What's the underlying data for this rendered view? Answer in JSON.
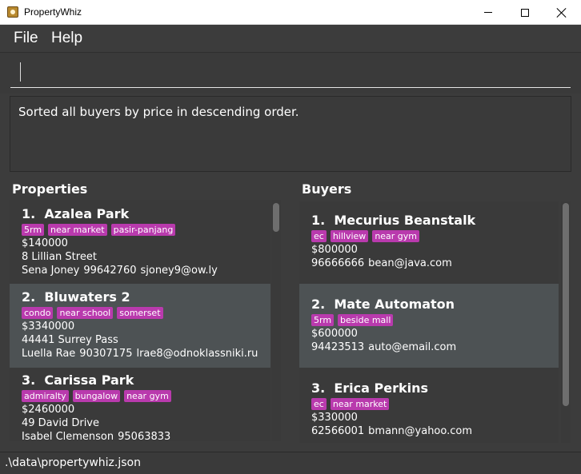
{
  "window": {
    "title": "PropertyWhiz"
  },
  "menu": {
    "file": "File",
    "help": "Help"
  },
  "command": {
    "value": "",
    "placeholder": ""
  },
  "result": {
    "text": "Sorted all buyers by price in descending order."
  },
  "properties": {
    "title": "Properties",
    "items": [
      {
        "index": "1.",
        "name": "Azalea Park",
        "tags": [
          "5rm",
          "near market",
          "pasir-panjang"
        ],
        "price": "$140000",
        "address": "8 Lillian Street",
        "seller": "Sena Joney",
        "phone": "99642760",
        "email": "sjoney9@ow.ly"
      },
      {
        "index": "2.",
        "name": "Bluwaters 2",
        "tags": [
          "condo",
          "near school",
          "somerset"
        ],
        "price": "$3340000",
        "address": "44441 Surrey Pass",
        "seller": "Luella Rae",
        "phone": "90307175",
        "email": "lrae8@odnoklassniki.ru"
      },
      {
        "index": "3.",
        "name": "Carissa Park",
        "tags": [
          "admiralty",
          "bungalow",
          "near gym"
        ],
        "price": "$2460000",
        "address": "49 David Drive",
        "seller": "Isabel Clemenson",
        "phone": "95063833",
        "email": ""
      }
    ]
  },
  "buyers": {
    "title": "Buyers",
    "items": [
      {
        "index": "1.",
        "name": "Mecurius Beanstalk",
        "tags": [
          "ec",
          "hillview",
          "near gym"
        ],
        "price": "$800000",
        "phone": "96666666",
        "email": "bean@java.com"
      },
      {
        "index": "2.",
        "name": "Mate Automaton",
        "tags": [
          "5rm",
          "beside mall"
        ],
        "price": "$600000",
        "phone": "94423513",
        "email": "auto@email.com"
      },
      {
        "index": "3.",
        "name": "Erica Perkins",
        "tags": [
          "ec",
          "near market"
        ],
        "price": "$330000",
        "phone": "62566001",
        "email": "bmann@yahoo.com"
      }
    ]
  },
  "status": {
    "path": ".\\data\\propertywhiz.json"
  },
  "colors": {
    "tag": "#b93aad",
    "background": "#3c3c3c",
    "selected_row": "#4d5254"
  }
}
